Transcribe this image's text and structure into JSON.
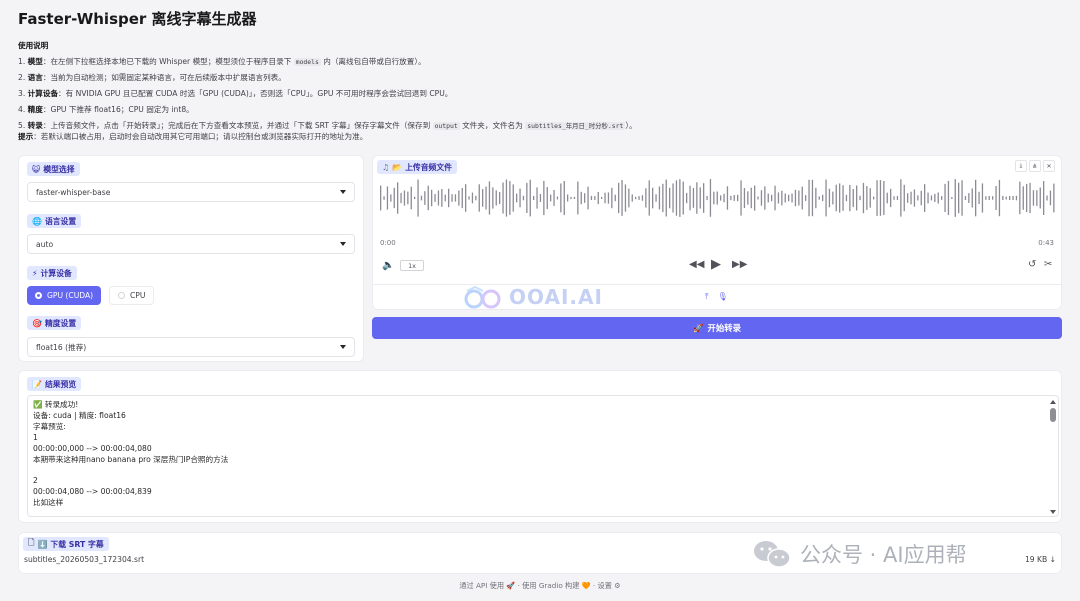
{
  "app": {
    "title": "Faster-Whisper 离线字幕生成器"
  },
  "instructions": {
    "heading": "使用说明",
    "items": [
      {
        "num": "1.",
        "key": "模型",
        "pre": "：在左侧下拉框选择本地已下载的 Whisper 模型；模型须位于程序目录下 ",
        "code": "models",
        "post": " 内（离线包自带或自行放置）。"
      },
      {
        "num": "2.",
        "key": "语言",
        "pre": "：当前为自动检测；如需固定某种语言，可在后续版本中扩展语言列表。",
        "code": "",
        "post": ""
      },
      {
        "num": "3.",
        "key": "计算设备",
        "pre": "：有 NVIDIA GPU 且已配置 CUDA 时选「GPU (CUDA)」，否则选「CPU」。GPU 不可用时程序会尝试回退到 CPU。",
        "code": "",
        "post": ""
      },
      {
        "num": "4.",
        "key": "精度",
        "pre": "：GPU 下推荐 float16；CPU 固定为 int8。",
        "code": "",
        "post": ""
      },
      {
        "num": "5.",
        "key": "转录",
        "pre": "：上传音频文件，点击「开始转录」；完成后在下方查看文本预览，并通过「下载 SRT 字幕」保存字幕文件（保存到 ",
        "code": "output",
        "post": " 文件夹，文件名为 ",
        "code2": "subtitles_年月日_时分秒.srt",
        "post2": "）。"
      }
    ],
    "tip_key": "提示",
    "tip": "：若默认端口被占用，启动时会自动改用其它可用端口；请以控制台或浏览器实际打开的地址为准。"
  },
  "left": {
    "model": {
      "icon": "😺",
      "label": "模型选择",
      "value": "faster-whisper-base"
    },
    "language": {
      "icon": "🌐",
      "label": "语言设置",
      "value": "auto"
    },
    "device": {
      "icon": "⚡",
      "label": "计算设备",
      "options": [
        "GPU (CUDA)",
        "CPU"
      ],
      "selected": "GPU (CUDA)"
    },
    "precision": {
      "icon": "🎯",
      "label": "精度设置",
      "value": "float16 (推荐)"
    }
  },
  "audio": {
    "label_icon": "📂",
    "label": "上传音频文件",
    "time_start": "0:00",
    "time_end": "0:43",
    "speed": "1x"
  },
  "transcribe_button": {
    "icon": "🚀",
    "label": "开始转录"
  },
  "result": {
    "icon": "📝",
    "label": "结果预览",
    "text": "✅ 转录成功!\n设备: cuda | 精度: float16\n字幕预览:\n1\n00:00:00,000 --> 00:00:04,080\n本期带来这种用nano banana pro 深层热门IP合照的方法\n\n2\n00:00:04,080 --> 00:00:04,839\n比如这样"
  },
  "download": {
    "icon": "⬇️",
    "label": "下载 SRT 字幕",
    "filename": "subtitles_20260503_172304.srt",
    "size": "19 KB"
  },
  "footer": {
    "api": "通过 API 使用",
    "gradio": "使用 Gradio 构建",
    "settings": "设置"
  },
  "watermarks": {
    "center": "OOAI.AI",
    "corner": "公众号 · AI应用帮"
  },
  "colors": {
    "accent": "#6366f1",
    "label_bg": "#e0e7ff"
  }
}
